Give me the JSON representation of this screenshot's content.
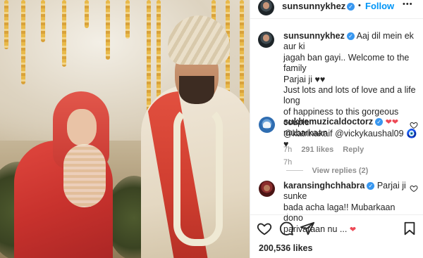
{
  "post": {
    "author": "sunsunnykhez",
    "dot": "•",
    "follow_label": "Follow",
    "more_label": "•••"
  },
  "caption": {
    "username": "sunsunnykhez",
    "line1": "Aaj dil mein ek aur ki",
    "line2": "jagah ban gayi.. Welcome to the family",
    "line3": "Parjai ji ♥♥",
    "line4": "Just lots and lots of love and a life long",
    "line5": "of happiness to this gorgeous couple",
    "line6": "@katrinakaif @vickykaushal09 🧿♥",
    "time": "7h"
  },
  "comments": [
    {
      "username": "sukhemuzicaldoctorz",
      "text": "mubarkaan",
      "time": "7h",
      "likes": "291 likes",
      "reply_label": "Reply",
      "view_replies": "View replies (2)",
      "hearts": "❤❤"
    },
    {
      "username": "karansinghchhabra",
      "text_line1": "Parjai ji sunke",
      "text_line2": "bada acha laga!! Mubarkaan dono",
      "text_line3": "parivaraan nu ...",
      "heart": "❤"
    }
  ],
  "actions": {
    "like_icon": "heart-outline",
    "comment_icon": "speech-bubble",
    "share_icon": "paper-plane",
    "save_icon": "bookmark"
  },
  "likes_count": "200,536 likes",
  "colors": {
    "link_blue": "#0095f6",
    "verified_blue": "#3897f0",
    "heart_red": "#ed4956",
    "muted": "#8e8e8e"
  }
}
